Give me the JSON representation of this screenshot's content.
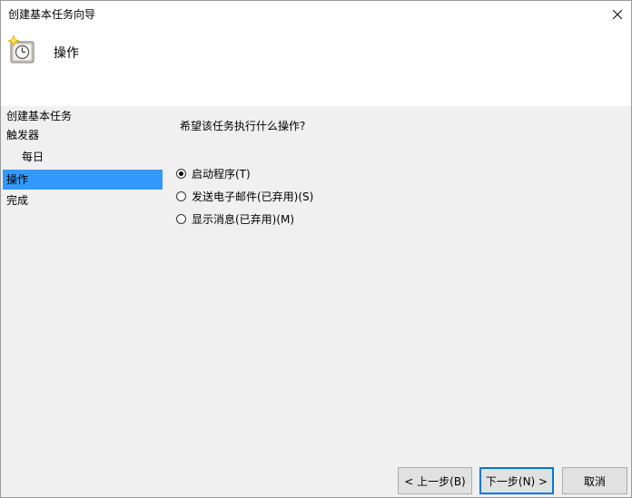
{
  "window": {
    "title": "创建基本任务向导",
    "close_symbol": "✕"
  },
  "header": {
    "title": "操作",
    "icon": "task-scheduler-icon"
  },
  "nav": {
    "items": [
      {
        "label": "创建基本任务"
      },
      {
        "label": "触发器"
      },
      {
        "label": "每日"
      },
      {
        "label": "操作"
      },
      {
        "label": "完成"
      }
    ],
    "selected": "操作"
  },
  "content": {
    "question": "希望该任务执行什么操作?",
    "options": [
      {
        "label": "启动程序(T)",
        "checked": true
      },
      {
        "label": "发送电子邮件(已弃用)(S)",
        "checked": false
      },
      {
        "label": "显示消息(已弃用)(M)",
        "checked": false
      }
    ]
  },
  "buttons": {
    "back": "< 上一步(B)",
    "next": "下一步(N) >",
    "cancel": "取消"
  },
  "colors": {
    "selection": "#3399ff",
    "panel": "#f0f0f0",
    "default_button_border": "#0078d7"
  }
}
